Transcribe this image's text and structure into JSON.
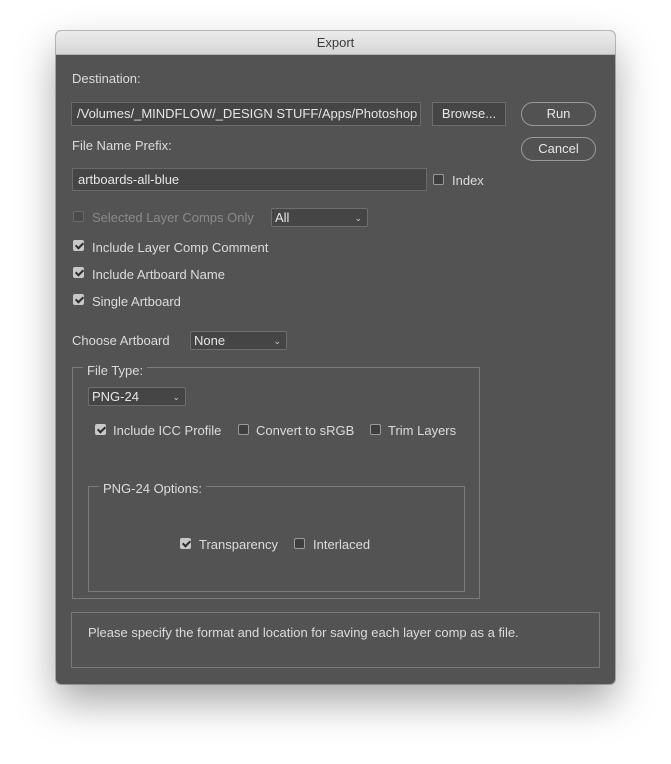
{
  "window": {
    "title": "Export"
  },
  "destination": {
    "label": "Destination:",
    "path": "/Volumes/_MINDFLOW/_DESIGN STUFF/Apps/Photoshop",
    "browse_label": "Browse..."
  },
  "actions": {
    "run_label": "Run",
    "cancel_label": "Cancel"
  },
  "prefix": {
    "label": "File Name Prefix:",
    "value": "artboards-all-blue",
    "index_label": "Index",
    "index_checked": false
  },
  "options": {
    "selected_layer_comps_only": {
      "label": "Selected Layer Comps Only",
      "checked": false,
      "enabled": false
    },
    "comps_select_value": "All",
    "include_layer_comp_comment": {
      "label": "Include Layer Comp Comment",
      "checked": true
    },
    "include_artboard_name": {
      "label": "Include Artboard Name",
      "checked": true
    },
    "single_artboard": {
      "label": "Single Artboard",
      "checked": true
    }
  },
  "choose_artboard": {
    "label": "Choose Artboard",
    "value": "None"
  },
  "file_type": {
    "legend": "File Type:",
    "value": "PNG-24",
    "include_icc": {
      "label": "Include ICC Profile",
      "checked": true
    },
    "convert_srgb": {
      "label": "Convert to sRGB",
      "checked": false
    },
    "trim_layers": {
      "label": "Trim Layers",
      "checked": false
    }
  },
  "png_options": {
    "legend": "PNG-24 Options:",
    "transparency": {
      "label": "Transparency",
      "checked": true
    },
    "interlaced": {
      "label": "Interlaced",
      "checked": false
    }
  },
  "help_text": "Please specify the format and location for saving each layer comp as a file."
}
